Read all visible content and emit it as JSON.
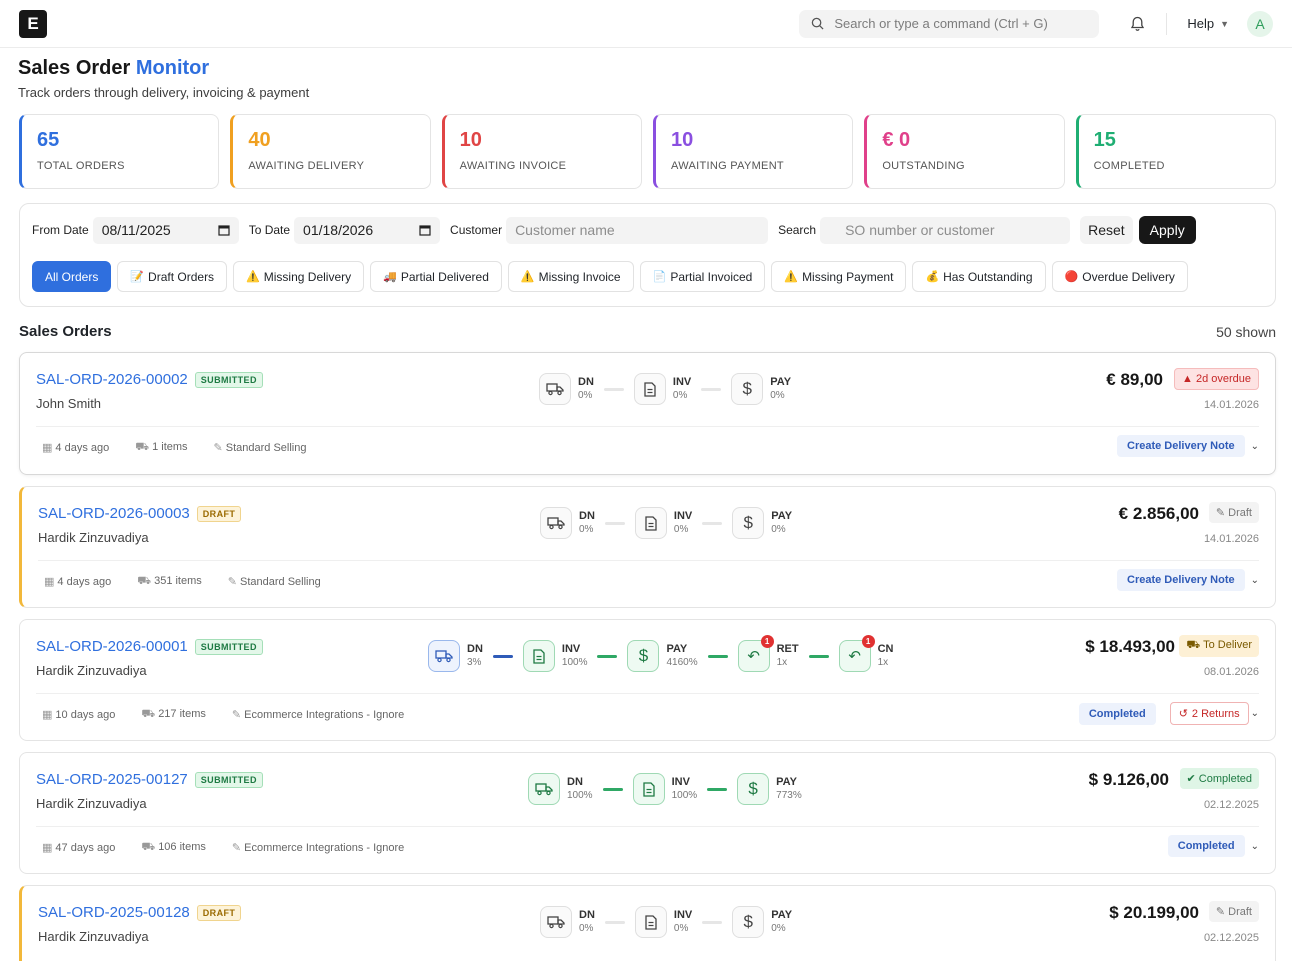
{
  "app": {
    "logo_letter": "E",
    "search_placeholder": "Search or type a command (Ctrl + G)",
    "help_label": "Help",
    "avatar_letter": "A"
  },
  "header": {
    "title_main": "Sales Order",
    "title_accent": "Monitor",
    "subtitle": "Track orders through delivery, invoicing & payment"
  },
  "stats": [
    {
      "value": "65",
      "label": "TOTAL ORDERS",
      "color": "#2f6fde"
    },
    {
      "value": "40",
      "label": "AWAITING DELIVERY",
      "color": "#f0a020"
    },
    {
      "value": "10",
      "label": "AWAITING INVOICE",
      "color": "#e04545"
    },
    {
      "value": "10",
      "label": "AWAITING PAYMENT",
      "color": "#8a4fe0"
    },
    {
      "value": "€ 0",
      "label": "OUTSTANDING",
      "color": "#e0408a"
    },
    {
      "value": "15",
      "label": "COMPLETED",
      "color": "#1fae73"
    }
  ],
  "filters": {
    "from_label": "From Date",
    "from_value": "08/11/2025",
    "to_label": "To Date",
    "to_value": "01/18/2026",
    "customer_label": "Customer",
    "customer_placeholder": "Customer name",
    "search_label": "Search",
    "search_placeholder": "SO number or customer",
    "reset_label": "Reset",
    "apply_label": "Apply",
    "chips": [
      {
        "icon": "",
        "label": "All Orders"
      },
      {
        "icon": "📝",
        "label": "Draft Orders"
      },
      {
        "icon": "⚠️",
        "label": "Missing Delivery"
      },
      {
        "icon": "🚚",
        "label": "Partial Delivered"
      },
      {
        "icon": "⚠️",
        "label": "Missing Invoice"
      },
      {
        "icon": "📄",
        "label": "Partial Invoiced"
      },
      {
        "icon": "⚠️",
        "label": "Missing Payment"
      },
      {
        "icon": "💰",
        "label": "Has Outstanding"
      },
      {
        "icon": "🔴",
        "label": "Overdue Delivery"
      }
    ]
  },
  "orders_section": {
    "title": "Sales Orders",
    "count": "50 shown"
  },
  "orders": [
    {
      "id": "SAL-ORD-2026-00002",
      "status": "SUBMITTED",
      "customer": "John Smith",
      "amount": "€ 89,00",
      "tag": "2d overdue",
      "date": "14.01.2026",
      "meta": {
        "age": "4 days ago",
        "items": "1 items",
        "type": "Standard Selling"
      },
      "pipeline": [
        {
          "label": "DN",
          "pct": "0%"
        },
        {
          "label": "INV",
          "pct": "0%"
        },
        {
          "label": "PAY",
          "pct": "0%"
        }
      ],
      "action": "Create Delivery Note"
    },
    {
      "id": "SAL-ORD-2026-00003",
      "status": "DRAFT",
      "customer": "Hardik Zinzuvadiya",
      "amount": "€ 2.856,00",
      "tag": "Draft",
      "date": "14.01.2026",
      "meta": {
        "age": "4 days ago",
        "items": "351 items",
        "type": "Standard Selling"
      },
      "pipeline": [
        {
          "label": "DN",
          "pct": "0%"
        },
        {
          "label": "INV",
          "pct": "0%"
        },
        {
          "label": "PAY",
          "pct": "0%"
        }
      ],
      "action": "Create Delivery Note"
    },
    {
      "id": "SAL-ORD-2026-00001",
      "status": "SUBMITTED",
      "customer": "Hardik Zinzuvadiya",
      "amount": "$ 18.493,00",
      "tag": "To Deliver",
      "date": "08.01.2026",
      "meta": {
        "age": "10 days ago",
        "items": "217 items",
        "type": "Ecommerce Integrations - Ignore"
      },
      "pipeline": [
        {
          "label": "DN",
          "pct": "3%"
        },
        {
          "label": "INV",
          "pct": "100%"
        },
        {
          "label": "PAY",
          "pct": "4160%"
        },
        {
          "label": "RET",
          "pct": "1x",
          "badge": "1"
        },
        {
          "label": "CN",
          "pct": "1x",
          "badge": "1"
        }
      ],
      "action": "Completed",
      "returns": "2 Returns"
    },
    {
      "id": "SAL-ORD-2025-00127",
      "status": "SUBMITTED",
      "customer": "Hardik Zinzuvadiya",
      "amount": "$ 9.126,00",
      "tag": "Completed",
      "date": "02.12.2025",
      "meta": {
        "age": "47 days ago",
        "items": "106 items",
        "type": "Ecommerce Integrations - Ignore"
      },
      "pipeline": [
        {
          "label": "DN",
          "pct": "100%"
        },
        {
          "label": "INV",
          "pct": "100%"
        },
        {
          "label": "PAY",
          "pct": "773%"
        }
      ],
      "action": "Completed"
    },
    {
      "id": "SAL-ORD-2025-00128",
      "status": "DRAFT",
      "customer": "Hardik Zinzuvadiya",
      "amount": "$ 20.199,00",
      "tag": "Draft",
      "date": "02.12.2025",
      "pipeline": [
        {
          "label": "DN",
          "pct": "0%"
        },
        {
          "label": "INV",
          "pct": "0%"
        },
        {
          "label": "PAY",
          "pct": "0%"
        }
      ]
    }
  ]
}
